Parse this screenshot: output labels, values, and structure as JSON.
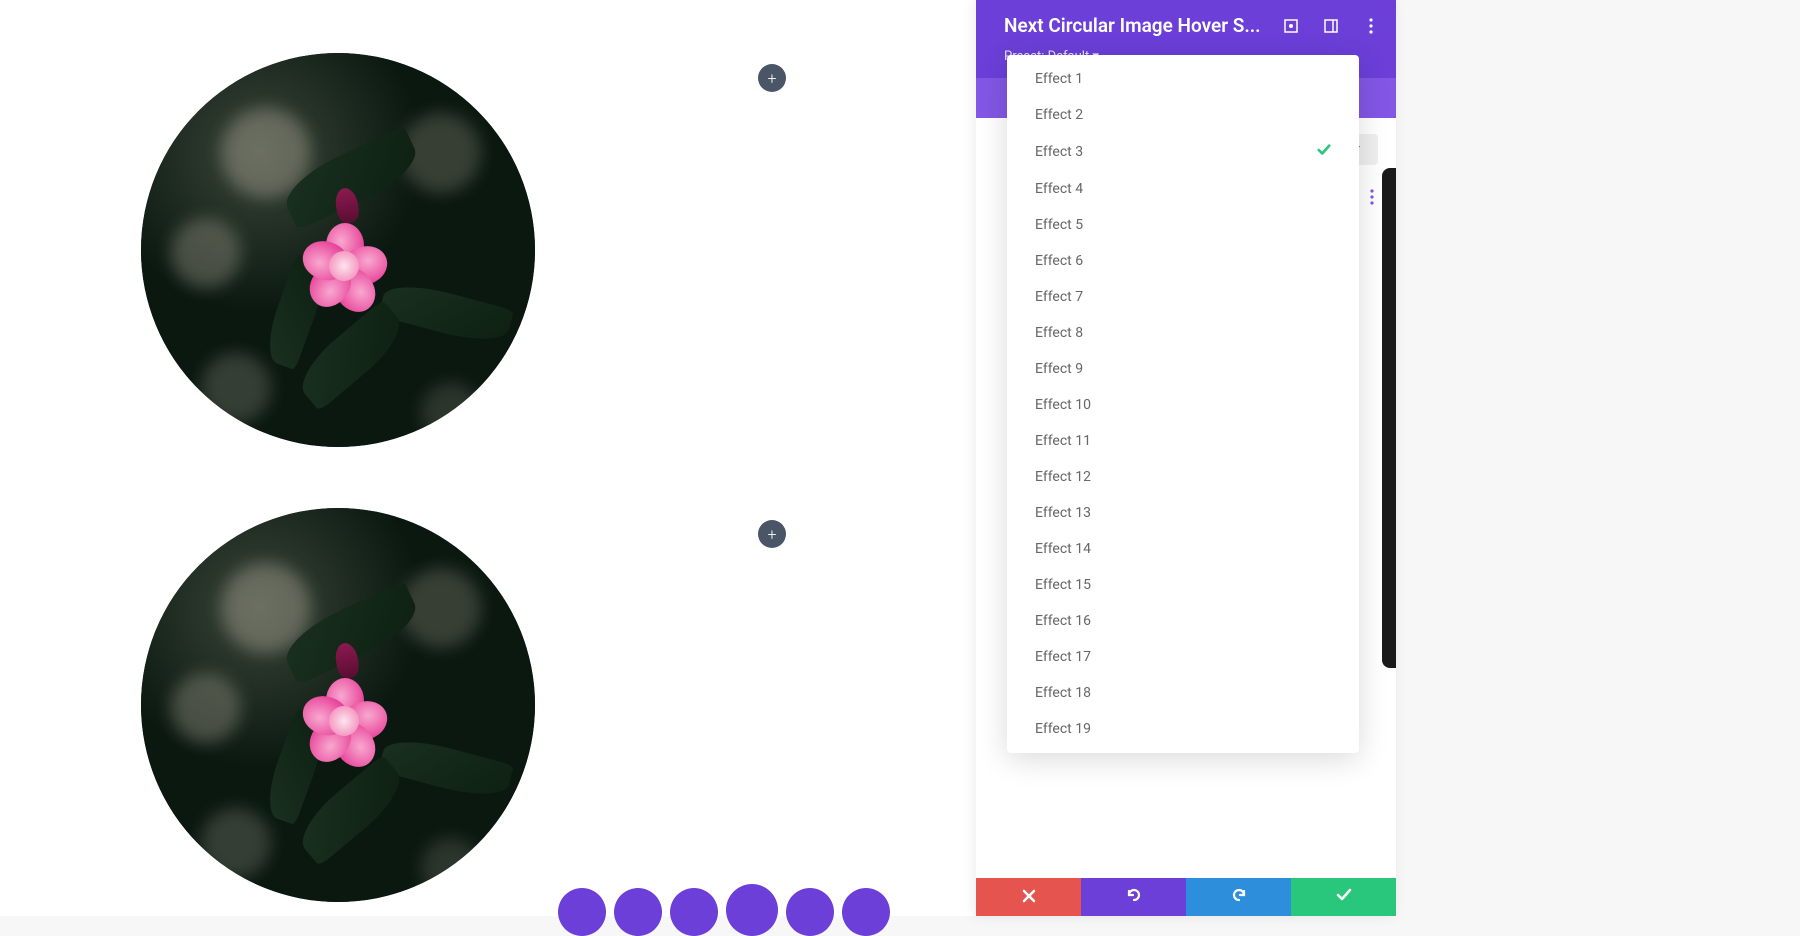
{
  "panel": {
    "title": "Next Circular Image Hover S...",
    "preset_label": "Preset: Default ▾"
  },
  "tabs": {
    "filter": "ter"
  },
  "dropdown": {
    "selected_index": 2,
    "items": [
      {
        "label": "Effect 1"
      },
      {
        "label": "Effect 2"
      },
      {
        "label": "Effect 3"
      },
      {
        "label": "Effect 4"
      },
      {
        "label": "Effect 5"
      },
      {
        "label": "Effect 6"
      },
      {
        "label": "Effect 7"
      },
      {
        "label": "Effect 8"
      },
      {
        "label": "Effect 9"
      },
      {
        "label": "Effect 10"
      },
      {
        "label": "Effect 11"
      },
      {
        "label": "Effect 12"
      },
      {
        "label": "Effect 13"
      },
      {
        "label": "Effect 14"
      },
      {
        "label": "Effect 15"
      },
      {
        "label": "Effect 16"
      },
      {
        "label": "Effect 17"
      },
      {
        "label": "Effect 18"
      },
      {
        "label": "Effect 19"
      }
    ]
  },
  "add_button_glyph": "+",
  "colors": {
    "primary": "#6b3fd8",
    "secondary": "#8257e5",
    "success": "#29c77c",
    "danger": "#e5544e",
    "info": "#2d8fdc"
  }
}
